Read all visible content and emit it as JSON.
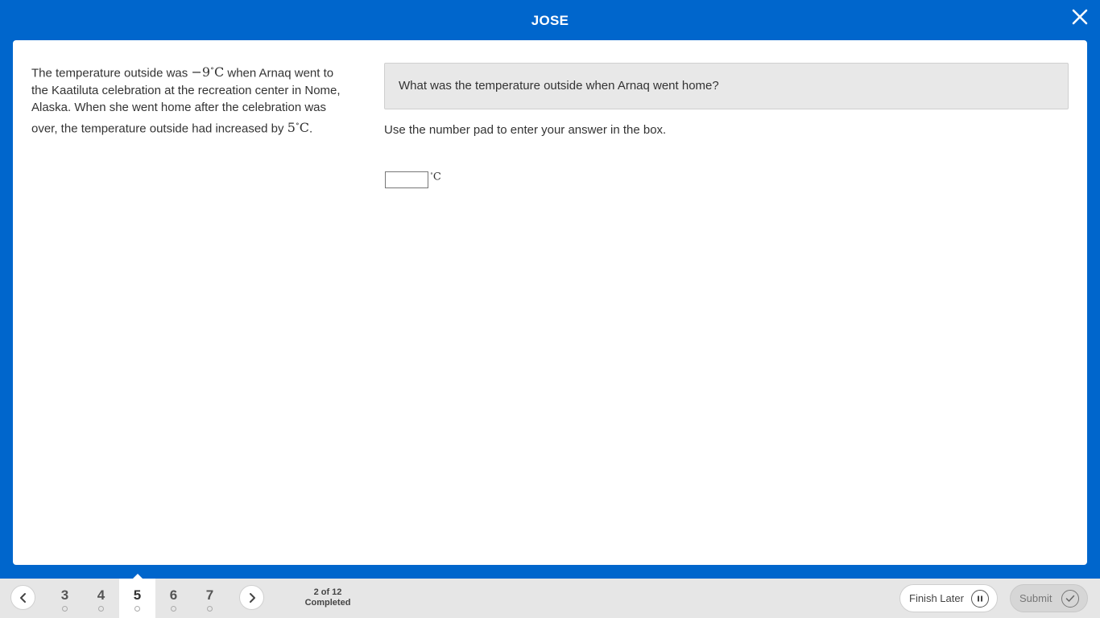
{
  "header": {
    "title": "JOSE"
  },
  "stimulus": {
    "part1": "The temperature outside was ",
    "math1_value": "−9",
    "math1_degree": "∘",
    "math1_unit": "C",
    "part2": " when Arnaq went to the Kaatiluta celebration at the recreation center in Nome, Alaska. When she went home after the celebration was over, the temperature outside had increased by ",
    "math2_value": "5",
    "math2_degree": "∘",
    "math2_unit": "C",
    "part3": "."
  },
  "question": {
    "prompt": "What was the temperature outside when Arnaq went home?",
    "instruction": "Use the number pad to enter your answer in the box.",
    "answer_value": "",
    "unit_degree": "∘",
    "unit_letter": "C"
  },
  "footer": {
    "tabs": [
      {
        "label": "3"
      },
      {
        "label": "4"
      },
      {
        "label": "5"
      },
      {
        "label": "6"
      },
      {
        "label": "7"
      }
    ],
    "active_tab": "5",
    "progress_count": "2 of 12",
    "progress_label": "Completed",
    "finish_later_label": "Finish Later",
    "submit_label": "Submit"
  },
  "icons": {
    "close": "close-icon",
    "prev": "chevron-left-icon",
    "next": "chevron-right-icon",
    "pause": "pause-icon",
    "check": "check-icon"
  },
  "colors": {
    "brand": "#0066cc",
    "footer_bg": "#e6e6e6",
    "question_bg": "#e8e8e8"
  }
}
